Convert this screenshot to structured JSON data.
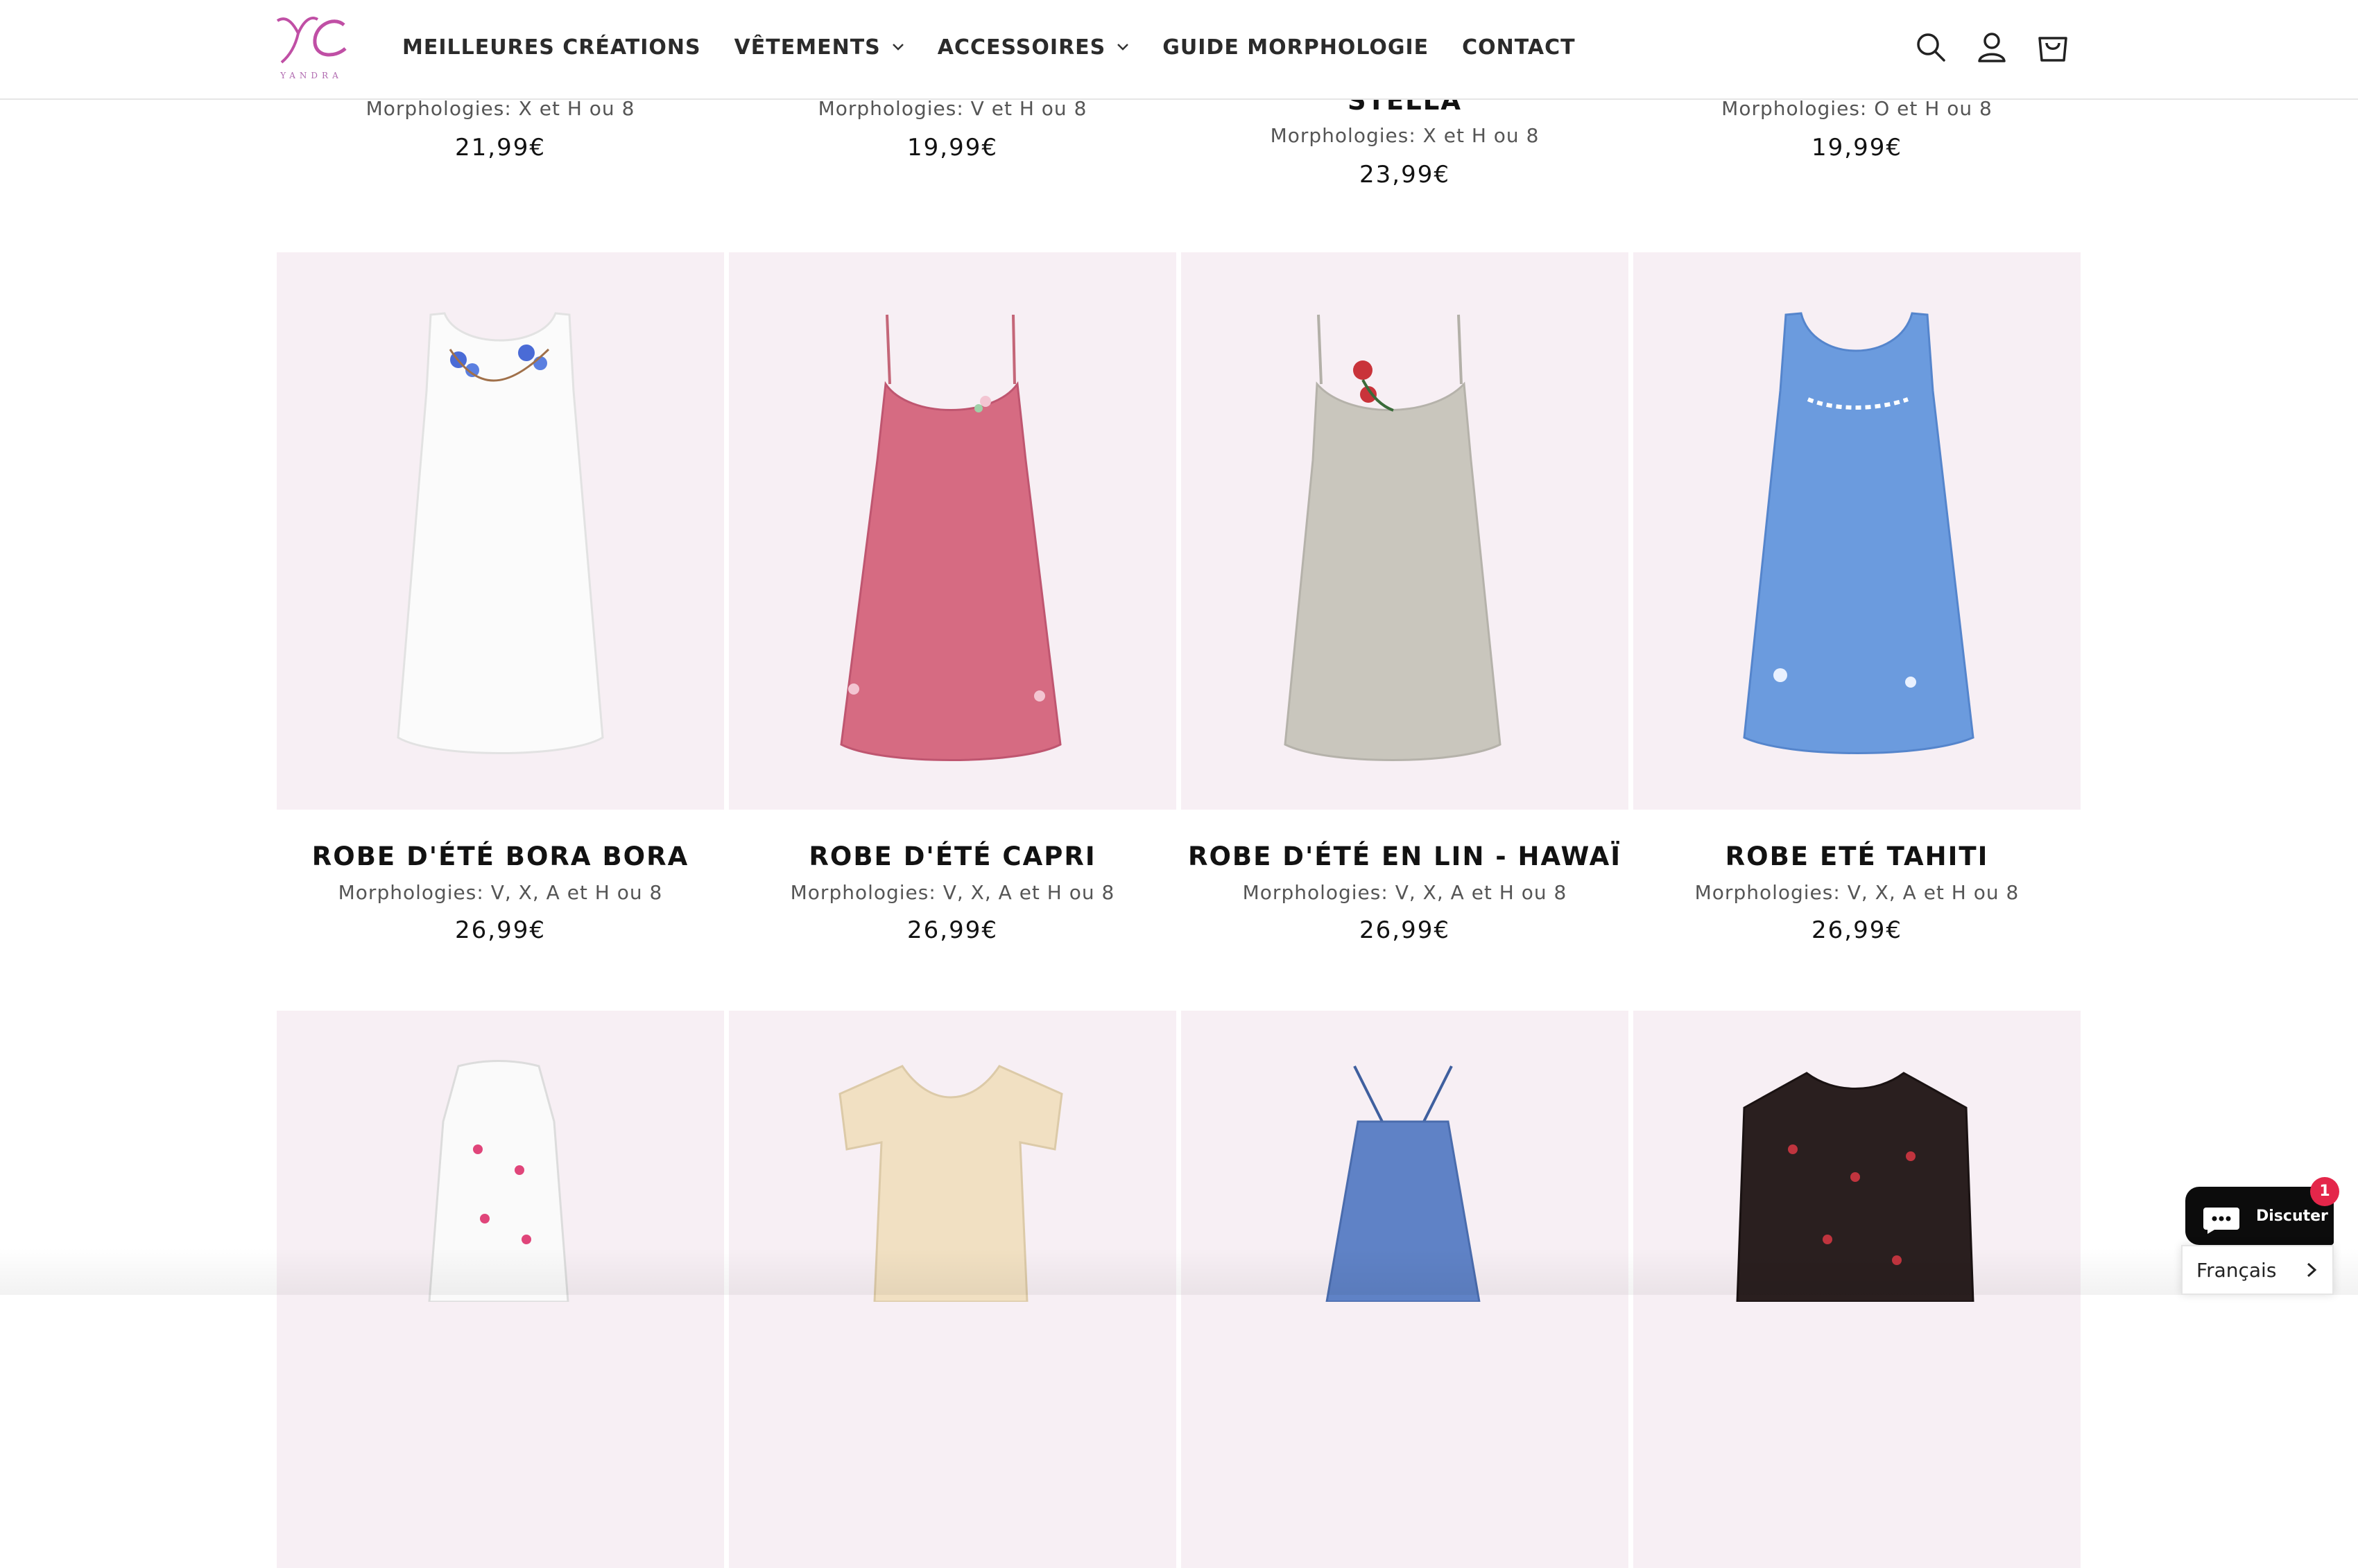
{
  "brand": {
    "logo_text": "YC",
    "word": "YANDRA"
  },
  "nav": {
    "items": [
      {
        "label": "MEILLEURES CRÉATIONS",
        "dropdown": false
      },
      {
        "label": "VÊTEMENTS",
        "dropdown": true
      },
      {
        "label": "ACCESSOIRES",
        "dropdown": true
      },
      {
        "label": "GUIDE MORPHOLOGIE",
        "dropdown": false
      },
      {
        "label": "CONTACT",
        "dropdown": false
      }
    ]
  },
  "header_icons": [
    "search-icon",
    "account-icon",
    "cart-icon"
  ],
  "row_top": [
    {
      "title": "",
      "morph": "Morphologies: X et H ou 8",
      "price": "21,99€"
    },
    {
      "title": "",
      "morph": "Morphologies: V et H ou 8",
      "price": "19,99€"
    },
    {
      "title": "STELLA",
      "morph": "Morphologies: X et H ou 8",
      "price": "23,99€"
    },
    {
      "title": "",
      "morph": "Morphologies: O et H ou 8",
      "price": "19,99€"
    }
  ],
  "row_main": [
    {
      "title": "ROBE D'ÉTÉ BORA BORA",
      "morph": "Morphologies: V, X, A et H ou 8",
      "price": "26,99€",
      "color": "#fbfbfb"
    },
    {
      "title": "ROBE D'ÉTÉ CAPRI",
      "morph": "Morphologies: V, X, A et H ou 8",
      "price": "26,99€",
      "color": "#d66b82"
    },
    {
      "title": "ROBE D'ÉTÉ EN LIN - HAWAÏ",
      "morph": "Morphologies: V, X, A et H ou 8",
      "price": "26,99€",
      "color": "#c9c6bd"
    },
    {
      "title": "ROBE ETÉ TAHITI",
      "morph": "Morphologies: V, X, A et H ou 8",
      "price": "26,99€",
      "color": "#6b9bde"
    }
  ],
  "row_bottom_colors": [
    "#fafafa",
    "#f1e0c2",
    "#5f82c6",
    "#2a1f1f"
  ],
  "chat": {
    "label": "Discuter",
    "badge": "1"
  },
  "language": {
    "label": "Français"
  },
  "colors": {
    "card_bg": "#f7eff4",
    "accent": "#c04fa5",
    "text": "#121212"
  }
}
